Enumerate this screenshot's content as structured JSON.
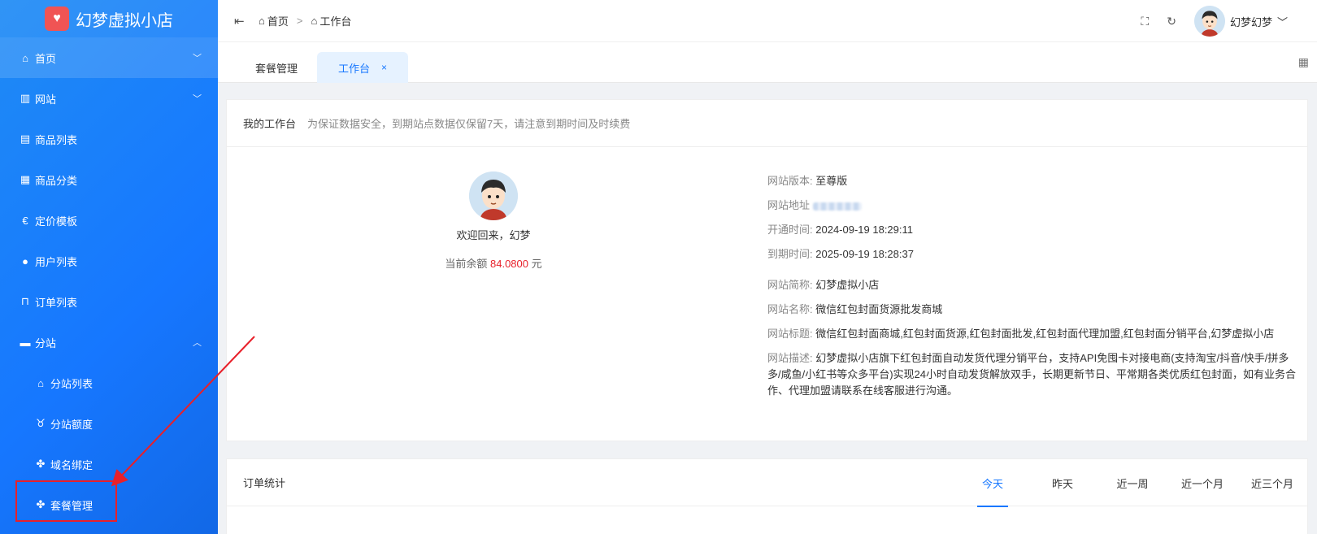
{
  "sidebar": {
    "logo_text": "幻梦虚拟小店",
    "items": [
      {
        "label": "首页",
        "icon": "home-icon",
        "chevron": "﹀"
      },
      {
        "label": "网站",
        "icon": "building-icon",
        "chevron": "﹀"
      },
      {
        "label": "商品列表",
        "icon": "list-icon"
      },
      {
        "label": "商品分类",
        "icon": "grid-icon"
      },
      {
        "label": "定价模板",
        "icon": "price-icon"
      },
      {
        "label": "用户列表",
        "icon": "user-icon"
      },
      {
        "label": "订单列表",
        "icon": "cart-icon"
      },
      {
        "label": "分站",
        "icon": "station-icon",
        "chevron": "︿"
      },
      {
        "label": "分站列表",
        "icon": "store-icon"
      },
      {
        "label": "分站额度",
        "icon": "quota-icon"
      },
      {
        "label": "域名绑定",
        "icon": "clover-icon"
      },
      {
        "label": "套餐管理",
        "icon": "clover-icon"
      }
    ]
  },
  "topbar": {
    "breadcrumb_home": "首页",
    "breadcrumb_sep": ">",
    "breadcrumb_current": "工作台",
    "user_name": "幻梦幻梦"
  },
  "tabs": [
    {
      "label": "套餐管理"
    },
    {
      "label": "工作台",
      "close": "×"
    }
  ],
  "workspace": {
    "title": "我的工作台",
    "note": "为保证数据安全，到期站点数据仅保留7天，请注意到期时间及时续费",
    "welcome": "欢迎回来，幻梦",
    "balance_label": "当前余额",
    "balance_value": "84.0800",
    "balance_unit": "元",
    "info": {
      "version_k": "网站版本:",
      "version_v": "至尊版",
      "address_k": "网站地址",
      "open_k": "开通时间:",
      "open_v": "2024-09-19 18:29:11",
      "expire_k": "到期时间:",
      "expire_v": "2025-09-19 18:28:37",
      "short_k": "网站简称:",
      "short_v": "幻梦虚拟小店",
      "name_k": "网站名称:",
      "name_v": "微信红包封面货源批发商城",
      "title_k": "网站标题:",
      "title_v": "微信红包封面商城,红包封面货源,红包封面批发,红包封面代理加盟,红包封面分销平台,幻梦虚拟小店",
      "desc_k": "网站描述:",
      "desc_v": "幻梦虚拟小店旗下红包封面自动发货代理分销平台，支持API免囤卡对接电商(支持淘宝/抖音/快手/拼多多/咸鱼/小红书等众多平台)实现24小时自动发货解放双手，长期更新节日、平常期各类优质红包封面，如有业务合作、代理加盟请联系在线客服进行沟通。"
    }
  },
  "stats": {
    "title": "订单统计",
    "periods": [
      "今天",
      "昨天",
      "近一周",
      "近一个月",
      "近三个月"
    ],
    "selected": "今天"
  },
  "colors": {
    "primary": "#1677ff",
    "accent_red": "#e8202a",
    "logo_red": "#f05454"
  }
}
